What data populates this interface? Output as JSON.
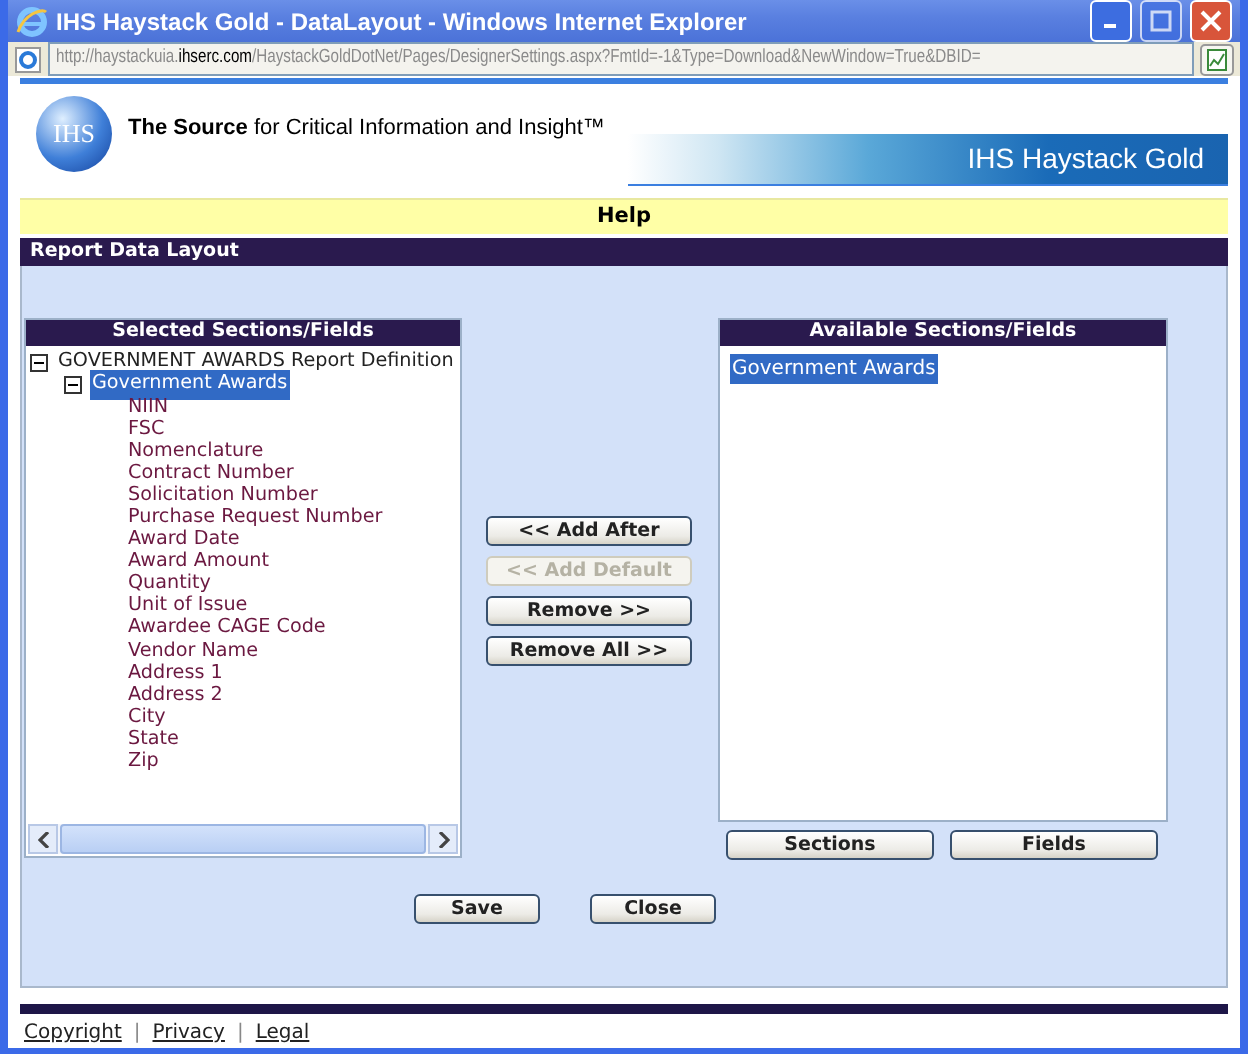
{
  "window": {
    "title": "IHS Haystack Gold - DataLayout - Windows Internet Explorer"
  },
  "address_bar": {
    "url_parts": [
      {
        "text": "http://haystackuia.",
        "highlighted": false
      },
      {
        "text": "ihserc.com",
        "highlighted": true
      },
      {
        "text": "/HaystackGoldDotNet/Pages/DesignerSettings.aspx?FmtId=-1&Type=Download&NewWindow=True&DBID=",
        "highlighted": false
      }
    ]
  },
  "header": {
    "logo_text": "IHS",
    "tagline": "**The Source** for Critical Information and Insight™",
    "banner_title": "IHS Haystack Gold"
  },
  "help_bar": {
    "label": "Help"
  },
  "section_title": "Report Data Layout",
  "selected_panel": {
    "title": "Selected Sections/Fields",
    "tree": [
      {
        "label": "GOVERNMENT AWARDS Report Definition",
        "expanded": true,
        "selected": false,
        "children": [
          {
            "label": "Government Awards",
            "expanded": true,
            "selected": true,
            "children": [
              {
                "label": "NIIN",
                "selected": false
              },
              {
                "label": "FSC",
                "selected": false
              },
              {
                "label": "Nomenclature",
                "selected": false
              },
              {
                "label": "Contract Number",
                "selected": false
              },
              {
                "label": "Solicitation Number",
                "selected": false
              },
              {
                "label": "Purchase Request Number",
                "selected": false
              },
              {
                "label": "Award Date",
                "selected": false
              },
              {
                "label": "Award Amount",
                "selected": false
              },
              {
                "label": "Quantity",
                "selected": false
              },
              {
                "label": "Unit of Issue",
                "selected": false
              },
              {
                "label": "Awardee CAGE Code",
                "selected": false
              },
              {
                "label": "Vendor Name",
                "selected": false
              },
              {
                "label": "Address 1",
                "selected": false
              },
              {
                "label": "Address 2",
                "selected": false
              },
              {
                "label": "City",
                "selected": false
              },
              {
                "label": "State",
                "selected": false
              },
              {
                "label": "Zip",
                "selected": false
              }
            ]
          }
        ]
      }
    ]
  },
  "move_buttons": [
    {
      "label": "<< Add After",
      "disabled": false
    },
    {
      "label": "<< Add Default",
      "disabled": true
    },
    {
      "label": "Remove >>",
      "disabled": false
    },
    {
      "label": "Remove All >>",
      "disabled": false
    }
  ],
  "available_panel": {
    "title": "Available Sections/Fields",
    "items": [
      {
        "label": "Government Awards",
        "selected": true
      }
    ]
  },
  "view_buttons": [
    {
      "label": "Sections",
      "disabled": false
    },
    {
      "label": "Fields",
      "disabled": false
    }
  ],
  "dialog_buttons": [
    {
      "label": "Save",
      "disabled": false
    },
    {
      "label": "Close",
      "disabled": false
    }
  ],
  "footer": [
    {
      "kind": "link",
      "text": "Copyright"
    },
    {
      "kind": "separator",
      "text": "|"
    },
    {
      "kind": "link",
      "text": "Privacy"
    },
    {
      "kind": "separator",
      "text": "|"
    },
    {
      "kind": "link",
      "text": "Legal"
    }
  ]
}
